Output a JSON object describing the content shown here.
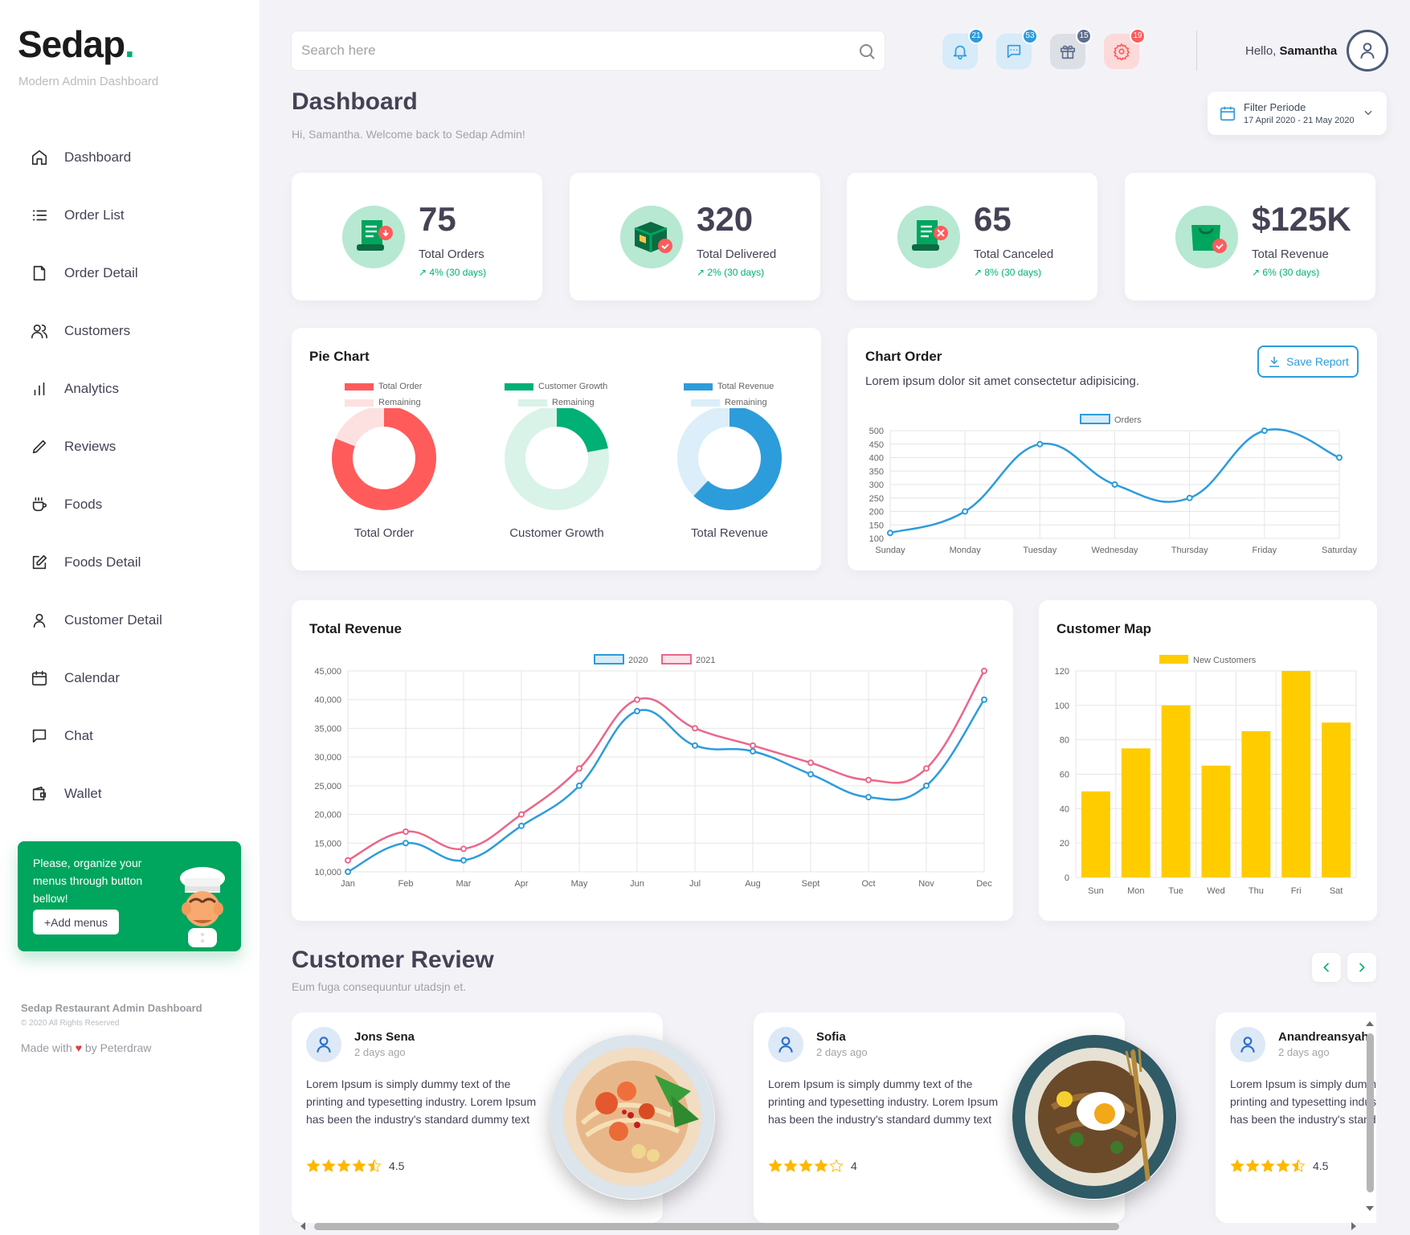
{
  "brand": {
    "name": "Sedap",
    "dot": ".",
    "subtitle": "Modern Admin Dashboard"
  },
  "sidebar": {
    "items": [
      {
        "label": "Dashboard",
        "icon": "home-icon"
      },
      {
        "label": "Order List",
        "icon": "list-icon"
      },
      {
        "label": "Order Detail",
        "icon": "document-icon"
      },
      {
        "label": "Customers",
        "icon": "users-icon"
      },
      {
        "label": "Analytics",
        "icon": "bar-chart-icon"
      },
      {
        "label": "Reviews",
        "icon": "pencil-icon"
      },
      {
        "label": "Foods",
        "icon": "cup-icon"
      },
      {
        "label": "Foods Detail",
        "icon": "edit-icon"
      },
      {
        "label": "Customer Detail",
        "icon": "user-icon"
      },
      {
        "label": "Calendar",
        "icon": "calendar-icon"
      },
      {
        "label": "Chat",
        "icon": "chat-icon"
      },
      {
        "label": "Wallet",
        "icon": "wallet-icon"
      }
    ],
    "promo": {
      "text": "Please, organize your menus through button bellow!",
      "button": "+Add menus"
    },
    "footer": {
      "title": "Sedap Restaurant Admin Dashboard",
      "copyright": "© 2020 All Rights Reserved",
      "made_with": "Made with",
      "heart": "♥",
      "by": "by Peterdraw"
    }
  },
  "header": {
    "search_placeholder": "Search here",
    "badges": {
      "notifications": "21",
      "messages": "53",
      "gifts": "15",
      "settings": "19"
    },
    "greeting": "Hello,",
    "user": "Samantha"
  },
  "page": {
    "title": "Dashboard",
    "subtitle": "Hi, Samantha. Welcome back to Sedap Admin!",
    "filter": {
      "title": "Filter Periode",
      "range": "17 April 2020 - 21 May 2020"
    }
  },
  "stats": [
    {
      "value": "75",
      "label": "Total Orders",
      "change": "↗ 4% (30 days)"
    },
    {
      "value": "320",
      "label": "Total Delivered",
      "change": "↗ 2% (30 days)"
    },
    {
      "value": "65",
      "label": "Total Canceled",
      "change": "↗ 8% (30 days)"
    },
    {
      "value": "$125K",
      "label": "Total Revenue",
      "change": "↗ 6% (30 days)"
    }
  ],
  "pie": {
    "title": "Pie Chart",
    "remaining": "Remaining",
    "donuts": [
      {
        "legend": "Total Order",
        "label": "Total Order",
        "color": "#ff5b5b",
        "light": "#fde1e1",
        "value": 0.81
      },
      {
        "legend": "Customer Growth",
        "label": "Customer Growth",
        "color": "#00b074",
        "light": "#d9f3e9",
        "value": 0.22
      },
      {
        "legend": "Total Revenue",
        "label": "Total Revenue",
        "color": "#2d9cdb",
        "light": "#dbeef9",
        "value": 0.62
      }
    ]
  },
  "chart_order": {
    "title": "Chart Order",
    "description": "Lorem ipsum dolor sit amet consectetur adipisicing.",
    "save_label": "Save Report"
  },
  "revenue_card": {
    "title": "Total Revenue"
  },
  "map_card": {
    "title": "Customer Map"
  },
  "chart_data": [
    {
      "type": "pie",
      "charts": [
        {
          "name": "Total Order",
          "slices": [
            {
              "label": "Total Order",
              "value": 81
            },
            {
              "label": "Remaining",
              "value": 19
            }
          ]
        },
        {
          "name": "Customer Growth",
          "slices": [
            {
              "label": "Customer Growth",
              "value": 22
            },
            {
              "label": "Remaining",
              "value": 78
            }
          ]
        },
        {
          "name": "Total Revenue",
          "slices": [
            {
              "label": "Total Revenue",
              "value": 62
            },
            {
              "label": "Remaining",
              "value": 38
            }
          ]
        }
      ]
    },
    {
      "type": "line",
      "title": "Chart Order",
      "categories": [
        "Sunday",
        "Monday",
        "Tuesday",
        "Wednesday",
        "Thursday",
        "Friday",
        "Saturday"
      ],
      "series": [
        {
          "name": "Orders",
          "values": [
            120,
            200,
            450,
            300,
            250,
            500,
            400
          ],
          "color": "#2d9cdb"
        }
      ],
      "ylim": [
        100,
        500
      ],
      "yticks": [
        "500",
        "450",
        "400",
        "350",
        "300",
        "250",
        "200",
        "150",
        "100"
      ],
      "grid": true,
      "legend": "top"
    },
    {
      "type": "line",
      "title": "Total Revenue",
      "categories": [
        "Jan",
        "Feb",
        "Mar",
        "Apr",
        "May",
        "Jun",
        "Jul",
        "Aug",
        "Sept",
        "Oct",
        "Nov",
        "Dec"
      ],
      "series": [
        {
          "name": "2020",
          "values": [
            10000,
            15000,
            12000,
            18000,
            25000,
            38000,
            32000,
            31000,
            27000,
            23000,
            25000,
            40000
          ],
          "color": "#2d9cdb"
        },
        {
          "name": "2021",
          "values": [
            12000,
            17000,
            14000,
            20000,
            28000,
            40000,
            35000,
            32000,
            29000,
            26000,
            28000,
            45000
          ],
          "color": "#e9678a"
        }
      ],
      "ylim": [
        10000,
        45000
      ],
      "yticks": [
        "45,000",
        "40,000",
        "35,000",
        "30,000",
        "25,000",
        "20,000",
        "15,000",
        "10,000"
      ],
      "grid": true,
      "legend": "top"
    },
    {
      "type": "bar",
      "title": "Customer Map",
      "categories": [
        "Sun",
        "Mon",
        "Tue",
        "Wed",
        "Thu",
        "Fri",
        "Sat"
      ],
      "series": [
        {
          "name": "New Customers",
          "values": [
            50,
            75,
            100,
            65,
            85,
            120,
            90
          ],
          "color": "#ffcc00"
        }
      ],
      "ylim": [
        0,
        120
      ],
      "yticks": [
        "120",
        "100",
        "80",
        "60",
        "40",
        "20",
        "0"
      ],
      "grid": true,
      "legend": "top"
    }
  ],
  "reviews": {
    "title": "Customer Review",
    "subtitle": "Eum fuga consequuntur utadsjn et.",
    "items": [
      {
        "name": "Jons Sena",
        "time": "2 days ago",
        "text": "Lorem Ipsum is simply dummy text of the printing and typesetting industry. Lorem Ipsum has been the industry's standard dummy text",
        "rating": 4.5,
        "score": "4.5"
      },
      {
        "name": "Sofia",
        "time": "2 days ago",
        "text": "Lorem Ipsum is simply dummy text of the printing and typesetting industry. Lorem Ipsum has been the industry's standard dummy text",
        "rating": 4,
        "score": "4"
      },
      {
        "name": "Anandreansyah",
        "time": "2 days ago",
        "text": "Lorem Ipsum is simply dummy text of the printing and typesetting industry. Lorem Ipsum has been the industry's standard dummy text",
        "rating": 4.5,
        "score": "4.5"
      }
    ]
  },
  "colors": {
    "accent": "#00b074",
    "blue": "#2d9cdb",
    "red": "#ff5b5b",
    "yellow": "#ffcc00",
    "pink": "#e9678a"
  }
}
